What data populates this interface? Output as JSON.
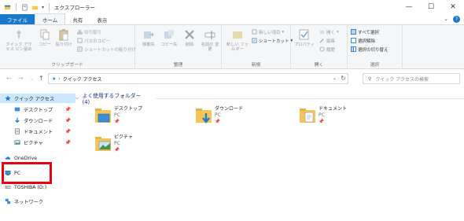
{
  "window": {
    "title": "エクスプローラー",
    "minimize": "—",
    "maximize": "☐",
    "close": "✕"
  },
  "tabs": [
    {
      "label": "ファイル"
    },
    {
      "label": "ホーム"
    },
    {
      "label": "共有"
    },
    {
      "label": "表示"
    }
  ],
  "ribbon": {
    "clipboard": {
      "label": "クリップボード",
      "pin": "クイック アクセス ピン留め",
      "copy": "コピー",
      "paste": "貼り付け",
      "cut": "切り取り",
      "copy_path": "パスのコピー",
      "paste_shortcut": "ショートカットの貼り付け"
    },
    "organize": {
      "label": "整理",
      "move_to": "移動先",
      "copy_to": "コピー先",
      "delete": "削除",
      "rename": "名前の 変更"
    },
    "new": {
      "label": "新規",
      "new_folder": "新しい フォルダー",
      "new_item": "新しい項目",
      "shortcut": "ショートカット"
    },
    "open": {
      "label": "開く",
      "properties": "プロパティ",
      "open": "開く",
      "edit": "編集",
      "history": "履歴"
    },
    "select": {
      "label": "選択",
      "select_all": "すべて選択",
      "select_none": "選択解除",
      "invert": "選択の切り替え"
    }
  },
  "address": {
    "path": "クイック アクセス",
    "search_placeholder": "クイック アクセスの検索"
  },
  "nav": {
    "items": [
      {
        "label": "クイック アクセス"
      },
      {
        "label": "デスクトップ"
      },
      {
        "label": "ダウンロード"
      },
      {
        "label": "ドキュメント"
      },
      {
        "label": "ピクチャ"
      },
      {
        "label": "OneDrive"
      },
      {
        "label": "PC"
      },
      {
        "label": "TOSHIBA (D:)"
      },
      {
        "label": "ネットワーク"
      }
    ]
  },
  "content": {
    "section_title": "よく使用するフォルダー (4)",
    "folders": [
      {
        "name": "デスクトップ",
        "location": "PC"
      },
      {
        "name": "ダウンロード",
        "location": "PC"
      },
      {
        "name": "ドキュメント",
        "location": "PC"
      },
      {
        "name": "ピクチャ",
        "location": "PC"
      }
    ]
  },
  "colors": {
    "accent": "#1979ca",
    "highlight_box": "#e60012",
    "selected_bg": "#cce8ff"
  }
}
